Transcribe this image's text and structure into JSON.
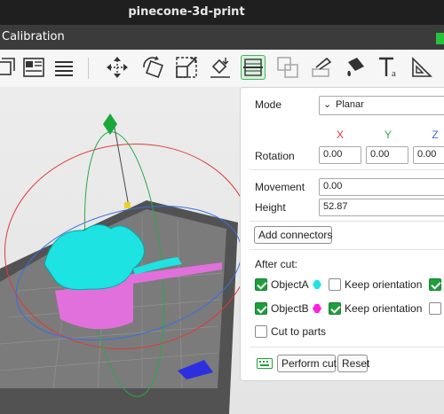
{
  "window": {
    "title": "pinecone-3d-print"
  },
  "tab": {
    "label": "Calibration"
  },
  "toolbar": {
    "icons": [
      "arrange-icon",
      "layout-icon",
      "list-icon",
      "move-icon",
      "rotate-icon",
      "scale-icon",
      "place-on-face-icon",
      "cut-icon",
      "boolean-icon",
      "support-paint-icon",
      "color-paint-icon",
      "text-icon",
      "measure-icon"
    ],
    "active": "cut-icon"
  },
  "cut_panel": {
    "mode_label": "Mode",
    "mode_value": "Planar",
    "axes": {
      "x": "X",
      "y": "Y",
      "z": "Z"
    },
    "axis_colors": {
      "x": "#e03a3a",
      "y": "#2aa84a",
      "z": "#3b6fe0"
    },
    "rotation_label": "Rotation",
    "rotation": [
      "0.00",
      "0.00",
      "0.00"
    ],
    "movement_label": "Movement",
    "movement": "0.00",
    "height_label": "Height",
    "height": "52.87",
    "add_connectors": "Add connectors",
    "after_cut_label": "After cut:",
    "object_a": {
      "label": "ObjectA",
      "color": "#1de3e3",
      "checked": true
    },
    "keep_orientation_a": {
      "label": "Keep orientation",
      "checked": false
    },
    "object_b": {
      "label": "ObjectB",
      "color": "#ff1fe0",
      "checked": true
    },
    "keep_orientation_b": {
      "label": "Keep orientation",
      "checked": true
    },
    "cut_to_parts": {
      "label": "Cut to parts",
      "checked": false
    },
    "perform_cut": "Perform cut",
    "reset": "Reset"
  },
  "colors": {
    "accent": "#1f9e3c",
    "part_a": "#1de3e3",
    "part_b": "#e86ee0"
  }
}
